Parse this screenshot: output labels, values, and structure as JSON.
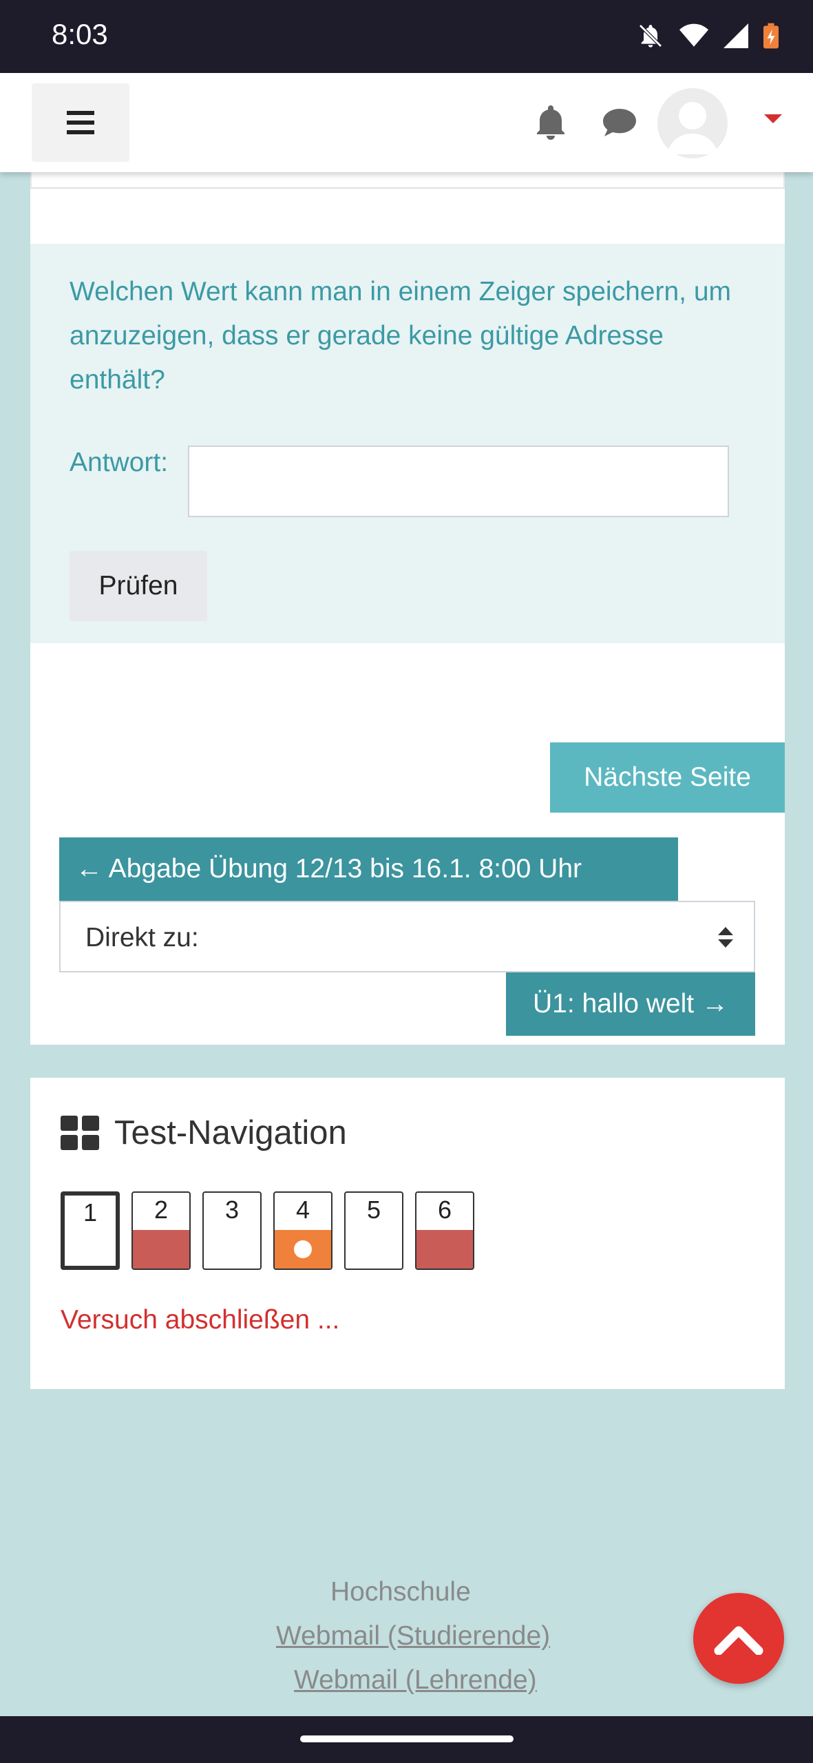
{
  "status_bar": {
    "time": "8:03",
    "icons": [
      "bell-off-icon",
      "wifi-icon",
      "signal-icon",
      "battery-charging-icon"
    ]
  },
  "header": {
    "menu_icon": "hamburger-menu-icon",
    "notification_icon": "bell-icon",
    "messages_icon": "chat-bubble-icon",
    "avatar_icon": "user-avatar",
    "dropdown_icon": "caret-down-icon",
    "accent_color": "#d32f2f"
  },
  "question": {
    "text": "Welchen Wert kann man in einem Zeiger speichern, um anzuzeigen, dass er gerade keine gültige Adresse enthält?",
    "answer_label": "Antwort:",
    "answer_value": "",
    "check_label": "Prüfen",
    "text_color": "#3b9aa4",
    "background_color": "#e8f3f4"
  },
  "navigation": {
    "next_page_label": "Nächste Seite",
    "prev_activity_label": "← Abgabe Übung 12/13 bis 16.1. 8:00 Uhr",
    "jump_to_label": "Direkt zu:",
    "next_activity_label": "Ü1: hallo welt →",
    "button_color": "#3b949e"
  },
  "quiz_nav": {
    "title": "Test-Navigation",
    "title_icon": "grid-icon",
    "questions": [
      {
        "number": "1",
        "state": "current"
      },
      {
        "number": "2",
        "state": "incorrect"
      },
      {
        "number": "3",
        "state": "unanswered"
      },
      {
        "number": "4",
        "state": "partially-correct"
      },
      {
        "number": "5",
        "state": "unanswered"
      },
      {
        "number": "6",
        "state": "incorrect"
      }
    ],
    "finish_label": "Versuch abschließen ...",
    "colors": {
      "incorrect": "#ca5c57",
      "partial": "#f0813a",
      "finish": "#d32f2f"
    }
  },
  "footer": {
    "title": "Hochschule",
    "links": [
      "Webmail (Studierende)",
      "Webmail (Lehrende)"
    ]
  },
  "back_to_top_icon": "chevron-up-icon"
}
